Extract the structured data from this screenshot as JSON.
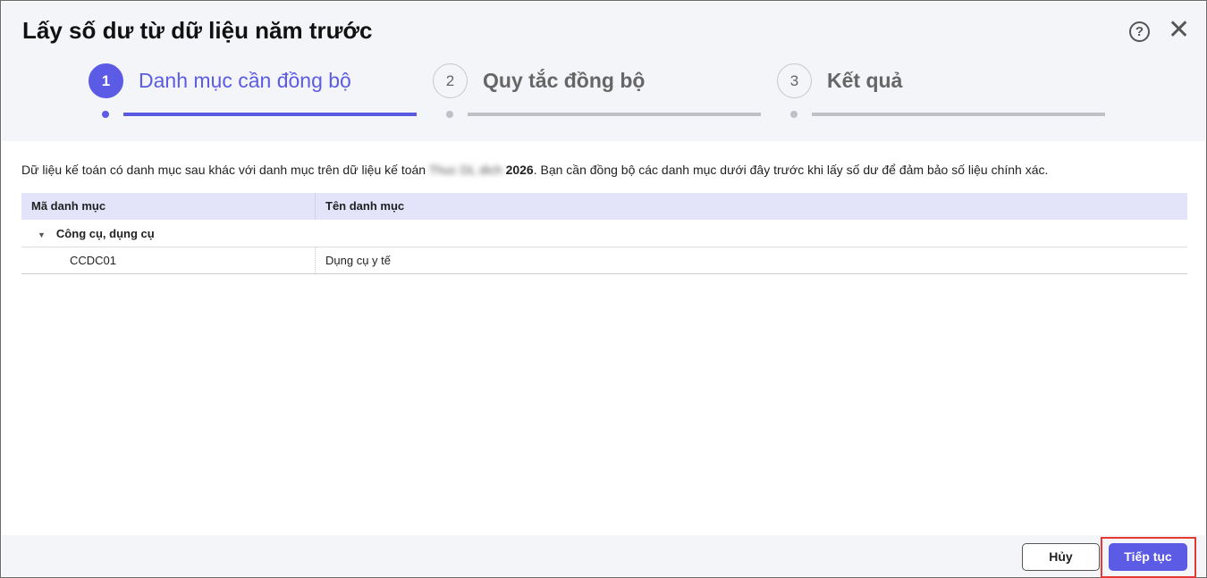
{
  "dialog": {
    "title": "Lấy số dư từ dữ liệu năm trước",
    "help_icon": "question-circle-icon",
    "close_icon": "close-icon"
  },
  "steps": [
    {
      "number": "1",
      "label": "Danh mục cần đồng bộ",
      "state": "active"
    },
    {
      "number": "2",
      "label": "Quy tắc đồng bộ",
      "state": "pending"
    },
    {
      "number": "3",
      "label": "Kết quả",
      "state": "pending"
    }
  ],
  "description": {
    "before": "Dữ liệu kế toán có danh mục sau khác với danh mục trên dữ liệu kế toán ",
    "blurred": "Thuc DL dich",
    "year": "2026",
    "after": ". Bạn cần đồng bộ các danh mục dưới đây trước khi lấy số dư để đảm bảo số liệu chính xác."
  },
  "table": {
    "columns": [
      "Mã danh mục",
      "Tên danh mục"
    ],
    "groups": [
      {
        "name": "Công cụ, dụng cụ",
        "expanded": true,
        "rows": [
          {
            "code": "CCDC01",
            "name": "Dụng cụ y tế"
          }
        ]
      }
    ]
  },
  "footer": {
    "cancel": "Hủy",
    "next": "Tiếp tục"
  },
  "colors": {
    "accent": "#5b5be6",
    "highlight": "#e53935"
  }
}
